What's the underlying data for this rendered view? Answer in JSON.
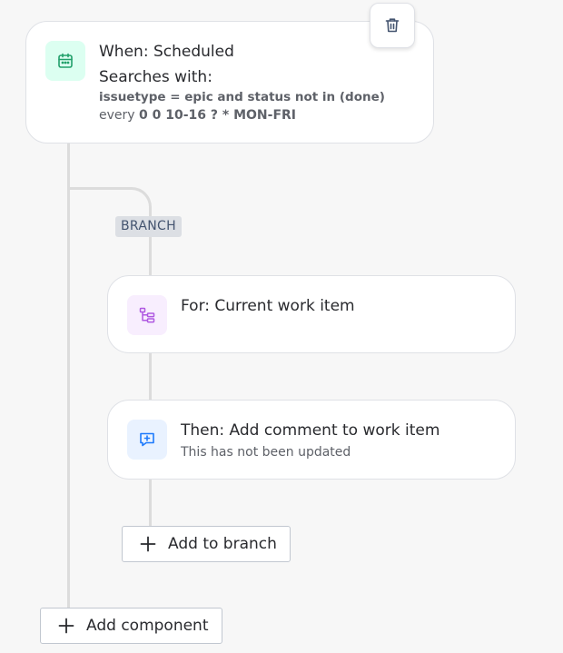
{
  "trigger": {
    "title": "When: Scheduled",
    "searches_label": "Searches with:",
    "jql": "issuetype = epic and status not in (done)",
    "cron_prefix": "every ",
    "cron": "0 0 10-16 ? * MON-FRI",
    "icon": "calendar-icon",
    "accent": "#22a06b",
    "tile_bg": "#dcfff1"
  },
  "delete_button": {
    "icon": "trash-icon"
  },
  "branch": {
    "badge": "BRANCH",
    "for_card": {
      "title": "For: Current work item",
      "icon": "branch-hierarchy-icon",
      "accent": "#af59e1",
      "tile_bg": "#f8eefe"
    },
    "action_card": {
      "title": "Then: Add comment to work item",
      "subtitle": "This has not been updated",
      "icon": "comment-add-icon",
      "accent": "#1d7afc",
      "tile_bg": "#e9f2ff"
    },
    "add_to_branch_label": "Add to branch"
  },
  "add_component_label": "Add component",
  "colors": {
    "connector": "#dcdcdc",
    "background": "#f7f7f7"
  }
}
